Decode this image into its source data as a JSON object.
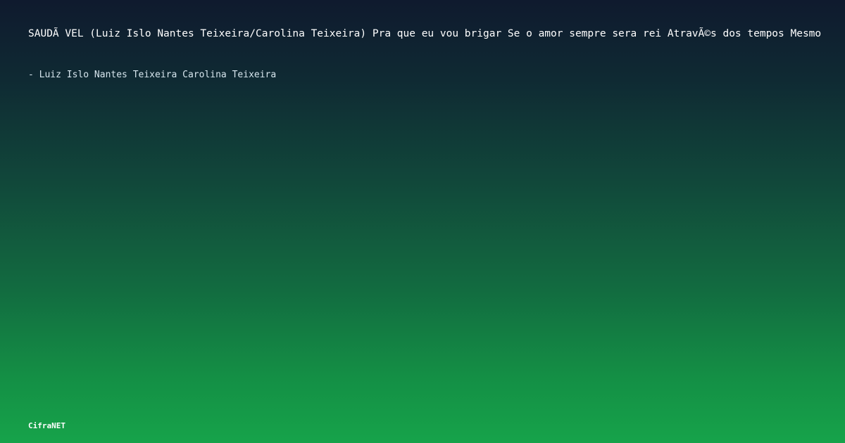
{
  "lyric": {
    "text": "SAUDÃ VEL (Luiz Islo Nantes Teixeira/Carolina Teixeira) Pra que eu vou brigar Se o amor sempre sera rei AtravÃ©s dos tempos Mesmo"
  },
  "author": {
    "text": "- Luiz Islo Nantes Teixeira Carolina Teixeira"
  },
  "brand": {
    "text": "CifraNET"
  },
  "colors": {
    "background_top": "#0f1a2e",
    "background_bottom": "#16a34a",
    "text": "#ffffff"
  }
}
